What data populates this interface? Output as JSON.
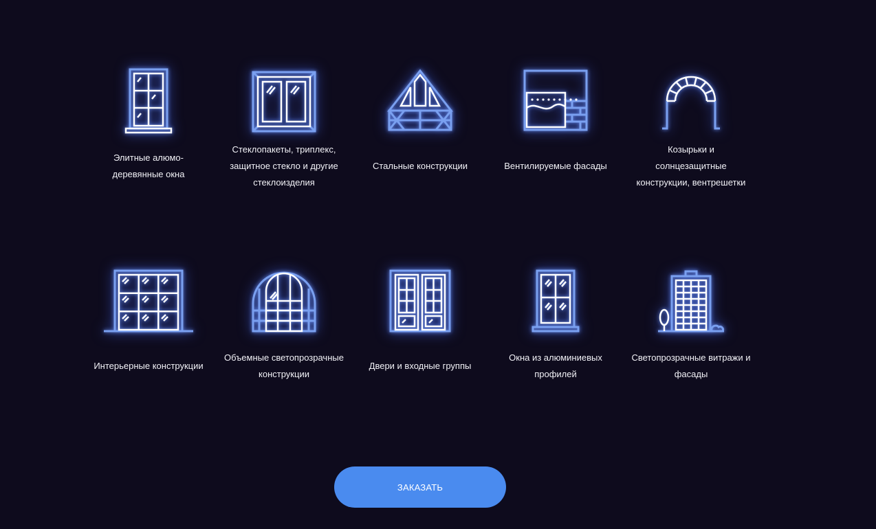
{
  "colors": {
    "background": "#0e0b1d",
    "icon_stroke": "#ffffff",
    "icon_outer": "#7aa0f0",
    "glow": "#5a7dff",
    "button": "#4a8bef",
    "button_text": "#ffffff",
    "label_text": "#f2f2f7"
  },
  "categories": [
    {
      "label": "Элитные алюмо-\nдеревянные окна",
      "icon": "window-icon"
    },
    {
      "label": "Стеклопакеты, триплекс,\nзащитное стекло и другие\nстеклоизделия",
      "icon": "double-glazing-icon"
    },
    {
      "label": "Стальные конструкции",
      "icon": "steel-truss-icon"
    },
    {
      "label": "Вентилируемые фасады",
      "icon": "ventilated-facade-icon"
    },
    {
      "label": "Козырьки и\nсолнцезащитные\nконструкции, вентрешетки",
      "icon": "arch-canopy-icon"
    },
    {
      "label": "Интерьерные конструкции",
      "icon": "interior-partition-icon"
    },
    {
      "label": "Объемные светопрозрачные\nконструкции",
      "icon": "dome-structure-icon"
    },
    {
      "label": "Двери и входные группы",
      "icon": "double-door-icon"
    },
    {
      "label": "Окна из алюминиевых\nпрофилей",
      "icon": "aluminum-window-icon"
    },
    {
      "label": "Светопрозрачные витражи и\nфасады",
      "icon": "glass-facade-building-icon"
    }
  ],
  "cta": {
    "label": "ЗАКАЗАТЬ"
  }
}
